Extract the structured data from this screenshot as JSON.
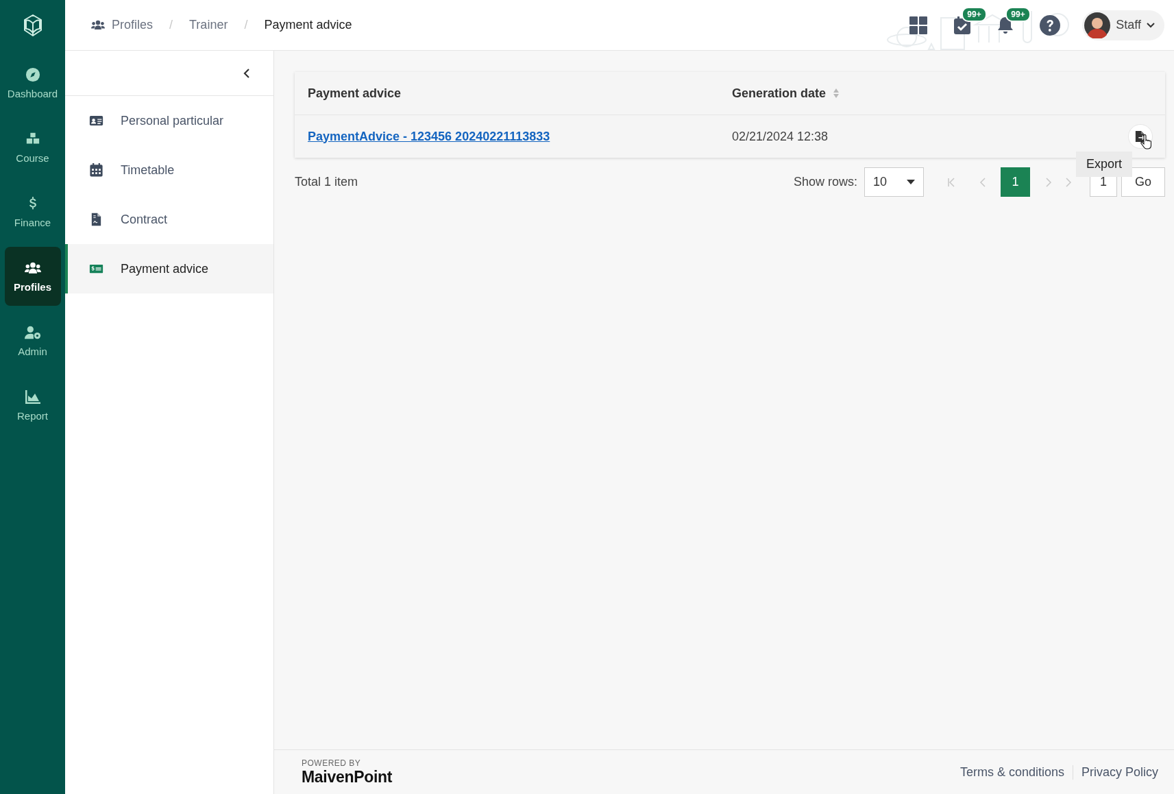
{
  "rail": {
    "items": [
      {
        "label": "Dashboard",
        "kind": "compass",
        "selected": false
      },
      {
        "label": "Course",
        "kind": "cubes",
        "selected": false
      },
      {
        "label": "Finance",
        "kind": "dollar",
        "selected": false
      },
      {
        "label": "Profiles",
        "kind": "people",
        "selected": true
      },
      {
        "label": "Admin",
        "kind": "usergear",
        "selected": false
      },
      {
        "label": "Report",
        "kind": "chart",
        "selected": false
      }
    ]
  },
  "breadcrumb": [
    {
      "label": "Profiles",
      "selected": false
    },
    {
      "separator": "/",
      "label": "Trainer",
      "selected": false
    },
    {
      "separator": "/",
      "label": "Payment advice",
      "selected": true
    }
  ],
  "topbar": {
    "tasks_badge": "99+",
    "notifications_badge": "99+",
    "user": "Staff"
  },
  "subnav": {
    "items": [
      {
        "label": "Personal particular",
        "kind": "idcard",
        "selected": false
      },
      {
        "label": "Timetable",
        "kind": "calendar",
        "selected": false
      },
      {
        "label": "Contract",
        "kind": "document",
        "selected": false
      },
      {
        "label": "Payment advice",
        "kind": "money",
        "selected": true
      }
    ]
  },
  "table": {
    "columns": [
      {
        "label": "Payment advice",
        "sortable": false
      },
      {
        "label": "Generation date",
        "sortable": true
      }
    ],
    "rows": [
      {
        "name": "PaymentAdvice - 123456 20240221113833",
        "date": "02/21/2024 12:38"
      }
    ],
    "tooltip": "Export"
  },
  "pagination": {
    "total": "Total 1 item",
    "show_rows_label": "Show rows:",
    "rows_value": "10",
    "pages": [
      {
        "label": "1",
        "selected": true
      }
    ],
    "jump_value": "1",
    "go": "Go"
  },
  "footer": {
    "powered_by": "POWERED BY",
    "brand": "MaivenPoint",
    "links": [
      "Terms & conditions",
      "Privacy Policy"
    ]
  }
}
